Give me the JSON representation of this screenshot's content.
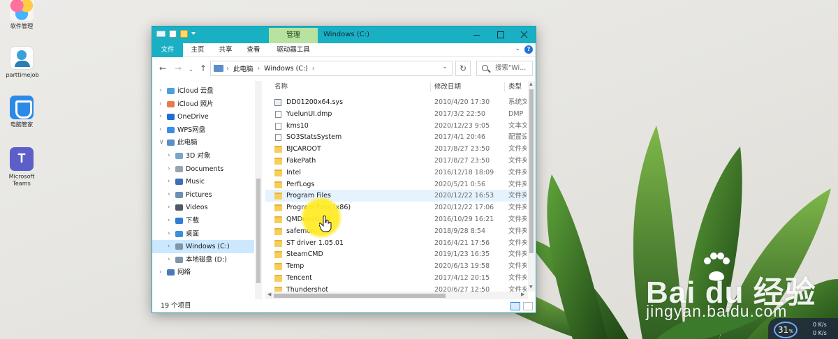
{
  "desktop_icons": [
    {
      "label": "软件管理",
      "icon": "software-manager-icon"
    },
    {
      "label": "parttimejob",
      "icon": "parttimejob-icon"
    },
    {
      "label": "电脑管家",
      "icon": "pc-guard-icon"
    },
    {
      "label": "Microsoft Teams",
      "icon": "teams-icon"
    }
  ],
  "window": {
    "title": "Windows (C:)",
    "contextual_tab": "管理",
    "ribbon_tabs": [
      "文件",
      "主页",
      "共享",
      "查看",
      "驱动器工具"
    ],
    "address": {
      "root": "此电脑",
      "current": "Windows (C:)"
    },
    "search_placeholder": "搜索\"Wi...",
    "nav_pane": [
      {
        "label": "iCloud 云盘",
        "icon": "cloud-icon",
        "level": 0
      },
      {
        "label": "iCloud 照片",
        "icon": "photos-icon",
        "level": 0
      },
      {
        "label": "OneDrive",
        "icon": "onedrive-icon",
        "level": 0
      },
      {
        "label": "WPS网盘",
        "icon": "wps-cloud-icon",
        "level": 0
      },
      {
        "label": "此电脑",
        "icon": "this-pc-icon",
        "level": 0,
        "expanded": true
      },
      {
        "label": "3D 对象",
        "icon": "3d-objects-icon",
        "level": 1
      },
      {
        "label": "Documents",
        "icon": "documents-icon",
        "level": 1
      },
      {
        "label": "Music",
        "icon": "music-icon",
        "level": 1
      },
      {
        "label": "Pictures",
        "icon": "pictures-icon",
        "level": 1
      },
      {
        "label": "Videos",
        "icon": "videos-icon",
        "level": 1
      },
      {
        "label": "下载",
        "icon": "download-icon",
        "level": 1
      },
      {
        "label": "桌面",
        "icon": "desktop-icon",
        "level": 1
      },
      {
        "label": "Windows (C:)",
        "icon": "drive-icon",
        "level": 1,
        "selected": true
      },
      {
        "label": "本地磁盘 (D:)",
        "icon": "drive-icon",
        "level": 1
      },
      {
        "label": "网络",
        "icon": "network-icon",
        "level": 0
      }
    ],
    "columns": {
      "name": "名称",
      "date": "修改日期",
      "type": "类型"
    },
    "files": [
      {
        "name": "DD01200x64.sys",
        "date": "2010/4/20 17:30",
        "type": "系统文",
        "kind": "sys"
      },
      {
        "name": "YuelunUI.dmp",
        "date": "2017/3/2 22:50",
        "type": "DMP",
        "kind": "doc"
      },
      {
        "name": "kms10",
        "date": "2020/12/23 9:05",
        "type": "文本文",
        "kind": "doc"
      },
      {
        "name": "SO3StatsSystem",
        "date": "2017/4/1 20:46",
        "type": "配置设",
        "kind": "doc"
      },
      {
        "name": "BJCAROOT",
        "date": "2017/8/27 23:50",
        "type": "文件夹",
        "kind": "folder"
      },
      {
        "name": "FakePath",
        "date": "2017/8/27 23:50",
        "type": "文件夹",
        "kind": "folder"
      },
      {
        "name": "Intel",
        "date": "2016/12/18 18:09",
        "type": "文件夹",
        "kind": "folder"
      },
      {
        "name": "PerfLogs",
        "date": "2020/5/21 0:56",
        "type": "文件夹",
        "kind": "folder"
      },
      {
        "name": "Program Files",
        "date": "2020/12/22 16:53",
        "type": "文件夹",
        "kind": "folder",
        "hover": true
      },
      {
        "name": "Program Files (x86)",
        "date": "2020/12/22 17:06",
        "type": "文件夹",
        "kind": "folder"
      },
      {
        "name": "QMDownload",
        "date": "2016/10/29 16:21",
        "type": "文件夹",
        "kind": "folder"
      },
      {
        "name": "safemon",
        "date": "2018/9/28 8:54",
        "type": "文件夹",
        "kind": "folder"
      },
      {
        "name": "ST driver 1.05.01",
        "date": "2016/4/21 17:56",
        "type": "文件夹",
        "kind": "folder"
      },
      {
        "name": "SteamCMD",
        "date": "2019/1/23 16:35",
        "type": "文件夹",
        "kind": "folder"
      },
      {
        "name": "Temp",
        "date": "2020/6/13 19:58",
        "type": "文件夹",
        "kind": "folder"
      },
      {
        "name": "Tencent",
        "date": "2017/4/12 20:15",
        "type": "文件夹",
        "kind": "folder"
      },
      {
        "name": "Thundershot",
        "date": "2020/6/27 12:50",
        "type": "文件夹",
        "kind": "folder"
      }
    ],
    "status_text": "19 个项目"
  },
  "watermark": {
    "brand": "Bai du 经验",
    "url": "jingyan.baidu.com"
  },
  "net_widget": {
    "percent": "31",
    "percent_unit": "%",
    "up": "0 K/s",
    "down": "0 K/s"
  },
  "colors": {
    "titlebar": "#1ab0c4",
    "manage_tab": "#b8e2a0",
    "selection": "#cce8ff",
    "folder": "#f6cf5a"
  }
}
